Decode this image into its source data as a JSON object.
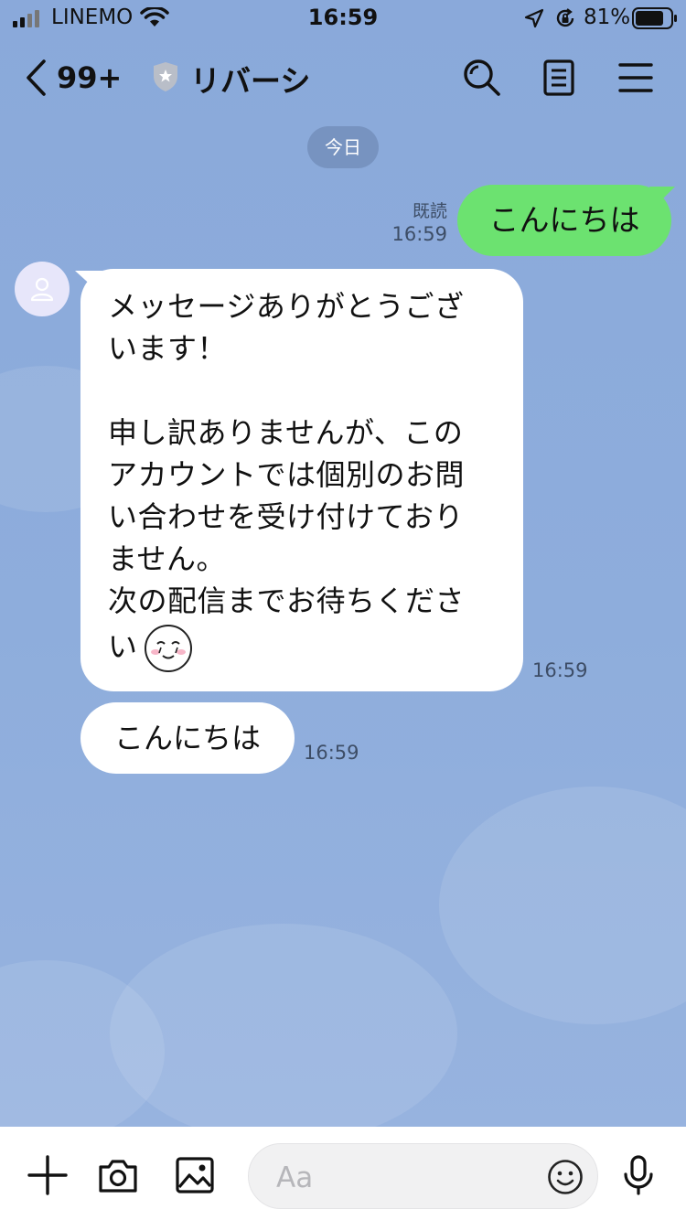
{
  "status_bar": {
    "carrier": "LINEMO",
    "time": "16:59",
    "battery": "81%",
    "battery_level": 0.81
  },
  "header": {
    "back_count": "99+",
    "title": "リバーシ",
    "icons": [
      "search-icon",
      "notes-icon",
      "menu-icon"
    ]
  },
  "date_chip": "今日",
  "outgoing": {
    "read_label": "既読",
    "time": "16:59",
    "text": "こんにちは"
  },
  "incoming": [
    {
      "lines": [
        "メッセージありがとうござ",
        "います！",
        "",
        "申し訳ありませんが、この",
        "アカウントでは個別のお問",
        "い合わせを受け付けており",
        "ません。",
        "次の配信までお待ちくださ",
        "い"
      ],
      "time": "16:59"
    },
    {
      "text": "こんにちは",
      "time": "16:59"
    }
  ],
  "input": {
    "placeholder": "Aa",
    "value": ""
  },
  "colors": {
    "background": "#8dacdc",
    "outgoing_bubble": "#6ce270",
    "incoming_bubble": "#ffffff",
    "avatar_bg": "#e7e6fa"
  }
}
